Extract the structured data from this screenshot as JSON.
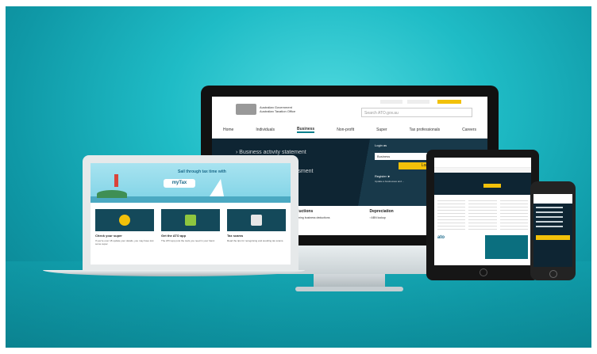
{
  "monitor": {
    "agency": "Australian Government",
    "agency_sub": "Australian Taxation Office",
    "search_placeholder": "Search ATO.gov.au",
    "tiny_links": [
      "",
      "",
      ""
    ],
    "nav": [
      "Home",
      "Individuals",
      "Business",
      "Non-profit",
      "Super",
      "Tax professionals",
      "Careers"
    ],
    "active_nav": "Business",
    "hero": {
      "line1": "› Business activity statement",
      "line2": "n",
      "line3": "ssessment"
    },
    "login": {
      "label": "Login as",
      "select_value": "Business",
      "button": "Login",
      "register": "Register ►",
      "note": "Update a businesses and ..."
    },
    "links": [
      {
        "title": "Deductions",
        "item": "› Claiming business deductions"
      },
      {
        "title": "Depreciation",
        "item": "› ABN lookup"
      }
    ]
  },
  "laptop": {
    "banner_text": "Sail through tax time with",
    "banner_logo": "myTax",
    "cards": [
      {
        "title": "Check your super",
        "text": "If you're over 18 update your details, you may have lost some super."
      },
      {
        "title": "Get the ATO app",
        "text": "The ATO app puts the tools you need in your hand."
      },
      {
        "title": "Tax scams",
        "text": "Read the tips for recognising and avoiding tax scams."
      }
    ]
  },
  "tablet": {
    "ato_logo": "ato"
  },
  "colors": {
    "background": "#1fbcc6",
    "accent_yellow": "#f2c10a",
    "hero_navy": "#0e2533"
  }
}
